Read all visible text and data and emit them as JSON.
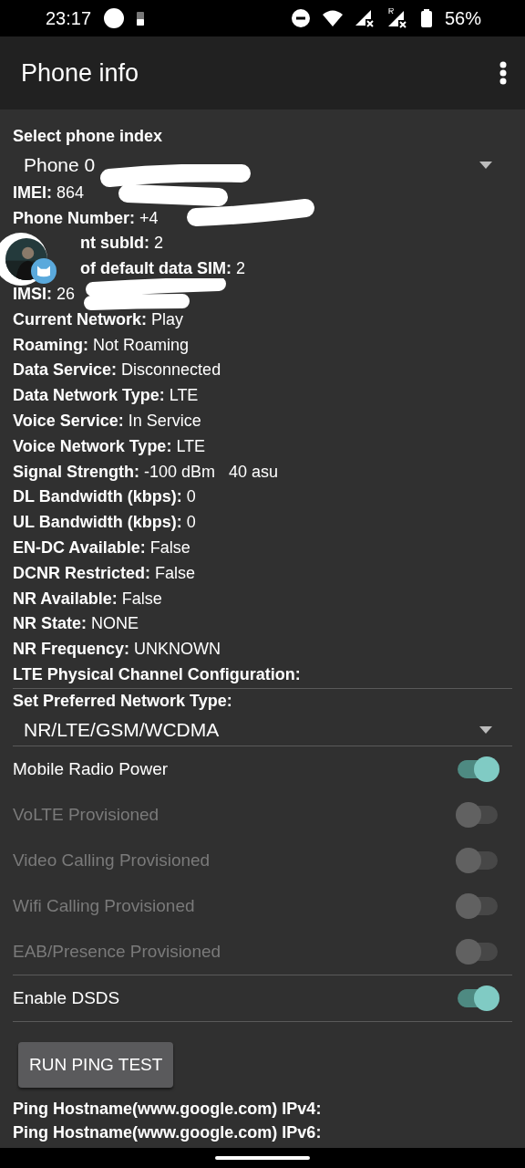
{
  "status_bar": {
    "time": "23:17",
    "battery": "56%"
  },
  "app_bar": {
    "title": "Phone info"
  },
  "phone_index": {
    "label": "Select phone index",
    "value": "Phone 0"
  },
  "info_rows": [
    {
      "label": "IMEI:",
      "value": "864",
      "kind": "plain"
    },
    {
      "label": "Phone Number:",
      "value": "+4",
      "kind": "plain"
    },
    {
      "label": "nt subId:",
      "value": "2",
      "kind": "behind_bubble"
    },
    {
      "label": "of default data SIM:",
      "value": "2",
      "kind": "behind_bubble"
    },
    {
      "label": "IMSI:",
      "value": "26",
      "kind": "plain"
    },
    {
      "label": "Current Network:",
      "value": "Play",
      "kind": "plain"
    },
    {
      "label": "Roaming:",
      "value": "Not Roaming",
      "kind": "plain"
    },
    {
      "label": "Data Service:",
      "value": "Disconnected",
      "kind": "plain"
    },
    {
      "label": "Data Network Type:",
      "value": "LTE",
      "kind": "plain"
    },
    {
      "label": "Voice Service:",
      "value": "In Service",
      "kind": "plain"
    },
    {
      "label": "Voice Network Type:",
      "value": "LTE",
      "kind": "plain"
    },
    {
      "label": "Signal Strength:",
      "value": "-100 dBm   40 asu",
      "kind": "plain"
    },
    {
      "label": "DL Bandwidth (kbps):",
      "value": "0",
      "kind": "plain"
    },
    {
      "label": "UL Bandwidth (kbps):",
      "value": "0",
      "kind": "plain"
    },
    {
      "label": "EN-DC Available:",
      "value": "False",
      "kind": "plain"
    },
    {
      "label": "DCNR Restricted:",
      "value": "False",
      "kind": "plain"
    },
    {
      "label": "NR Available:",
      "value": "False",
      "kind": "plain"
    },
    {
      "label": "NR State:",
      "value": "NONE",
      "kind": "plain"
    },
    {
      "label": "NR Frequency:",
      "value": "UNKNOWN",
      "kind": "plain"
    },
    {
      "label": "LTE Physical Channel Configuration:",
      "kind": "plain"
    }
  ],
  "network_type": {
    "label": "Set Preferred Network Type:",
    "value": "NR/LTE/GSM/WCDMA"
  },
  "toggles": [
    {
      "label": "Mobile Radio Power",
      "on": true,
      "disabled": false
    },
    {
      "label": "VoLTE Provisioned",
      "on": false,
      "disabled": true
    },
    {
      "label": "Video Calling Provisioned",
      "on": false,
      "disabled": true
    },
    {
      "label": "Wifi Calling Provisioned",
      "on": false,
      "disabled": true
    },
    {
      "label": "EAB/Presence Provisioned",
      "on": false,
      "disabled": true
    }
  ],
  "dsds_toggle": {
    "label": "Enable DSDS",
    "on": true,
    "disabled": false
  },
  "ping_button": "RUN PING TEST",
  "ping_rows": [
    "Ping Hostname(www.google.com) IPv4:",
    "Ping Hostname(www.google.com) IPv6:"
  ]
}
